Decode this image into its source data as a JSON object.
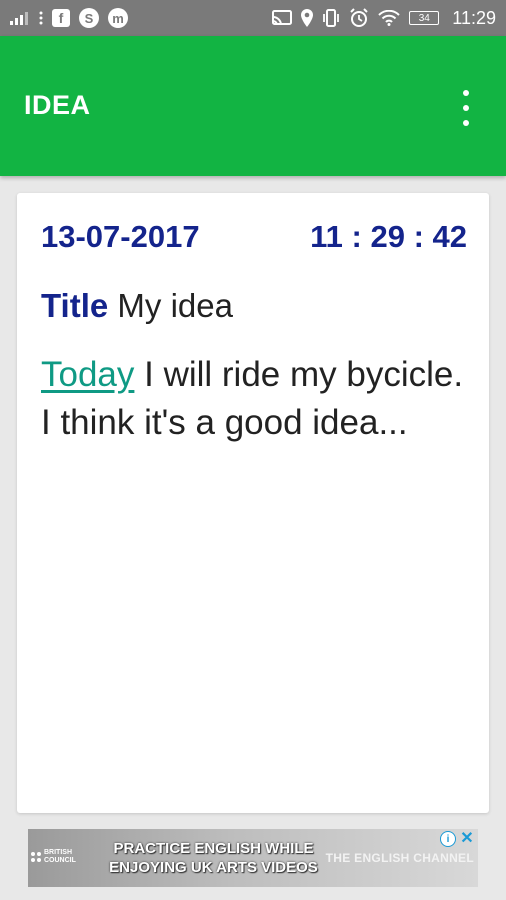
{
  "status_bar": {
    "left_icons": [
      "signal-bars-icon",
      "more-dots-icon",
      "facebook-icon",
      "skype-icon",
      "messenger-icon"
    ],
    "right_icons": [
      "cast-icon",
      "location-icon",
      "vibrate-icon",
      "alarm-icon",
      "wifi-icon",
      "battery-icon"
    ],
    "facebook_glyph": "f",
    "skype_glyph": "S",
    "messenger_glyph": "m",
    "battery_level": "34",
    "time": "11:29"
  },
  "app_bar": {
    "title": "IDEA",
    "color": "#12b443"
  },
  "note": {
    "date": "13-07-2017",
    "time": "11 : 29 : 42",
    "title_label": "Title",
    "title_value": "My idea",
    "link_word": "Today",
    "body_rest": " I will ride my bycicle. I think it's a good idea...",
    "accent_color": "#14248c",
    "link_color": "#0f9a84"
  },
  "ad_banner": {
    "sponsor_line1": "BRITISH",
    "sponsor_line2": "COUNCIL",
    "headline_line1": "PRACTICE ENGLISH WHILE",
    "headline_line2": "ENJOYING UK ARTS VIDEOS",
    "brand": "THE ENGLISH CHANNEL",
    "info_glyph": "i",
    "close_glyph": "✕"
  }
}
